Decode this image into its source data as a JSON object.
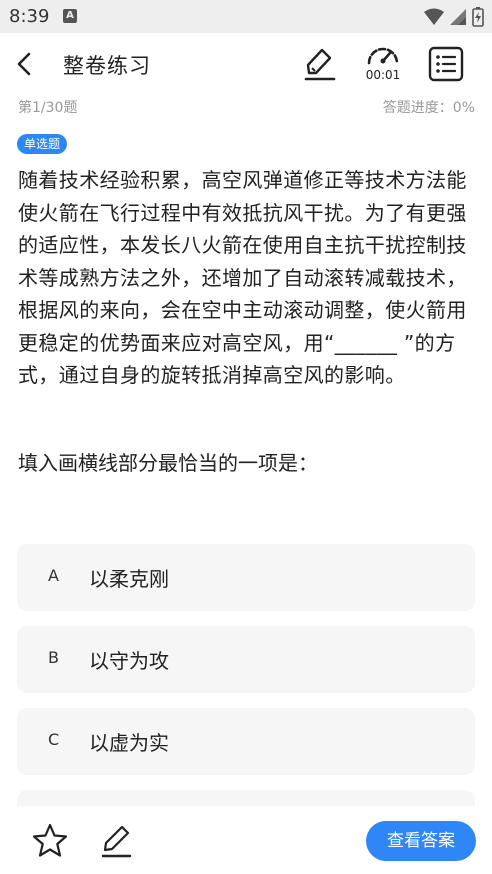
{
  "status_bar": {
    "time": "8:39",
    "notification_icon": "A",
    "icons": [
      "wifi-icon",
      "signal-icon",
      "battery-charging-icon"
    ]
  },
  "header": {
    "title": "整卷练习",
    "timer": "00:01",
    "icons": {
      "back": "chevron-left-icon",
      "pen": "pen-icon",
      "timer": "speedometer-icon",
      "list": "list-icon"
    }
  },
  "progress": {
    "question_number": "第1/30题",
    "answer_progress": "答题进度：0%"
  },
  "question": {
    "type": "单选题",
    "text": "随着技术经验积累，高空风弹道修正等技术方法能使火箭在飞行过程中有效抵抗风干扰。为了有更强的适应性，本发长八火箭在使用自主抗干扰控制技术等成熟方法之外，还增加了自动滚转减载技术，根据风的来向，会在空中主动滚动调整，使火箭用更稳定的优势面来应对高空风，用“______ ”的方式，通过自身的旋转抵消掉高空风的影响。",
    "prompt": "填入画横线部分最恰当的一项是："
  },
  "options": [
    {
      "letter": "A",
      "text": "以柔克刚"
    },
    {
      "letter": "B",
      "text": "以守为攻"
    },
    {
      "letter": "C",
      "text": "以虚为实"
    }
  ],
  "bottom_bar": {
    "answer_button": "查看答案",
    "icons": {
      "favorite": "star-icon",
      "note": "edit-icon"
    }
  },
  "colors": {
    "accent": "#2f86f6",
    "option_bg": "#f6f6f6",
    "muted_text": "#999999"
  }
}
